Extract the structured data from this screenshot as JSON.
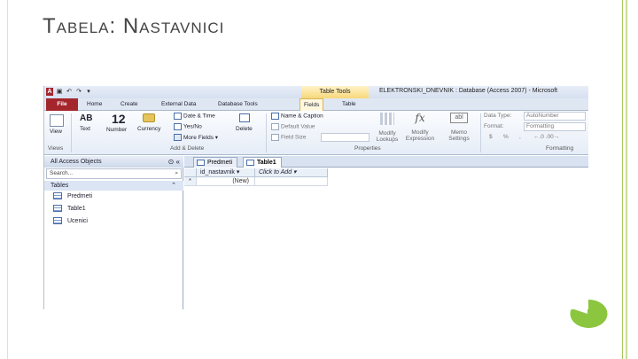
{
  "slide": {
    "title_first": "T",
    "title_rest1": "ABELA",
    "title_colon": ": ",
    "title_first2": "N",
    "title_rest2": "ASTAVNICI",
    "accent_color": "#8cc63f"
  },
  "access": {
    "context_tab_label": "Table Tools",
    "window_title": "ELEKTRONSKI_DNEVNIK : Database (Access 2007) - Microsoft",
    "tabs": [
      "File",
      "Home",
      "Create",
      "External Data",
      "Database Tools",
      "Fields",
      "Table"
    ],
    "ribbon": {
      "view": "View",
      "text": "Text",
      "number": "Number",
      "currency": "Currency",
      "ab_glyph": "AB",
      "twelve_glyph": "12",
      "date_time": "Date & Time",
      "yes_no": "Yes/No",
      "more_fields": "More Fields",
      "delete": "Delete",
      "name_caption": "Name & Caption",
      "default_value": "Default Value",
      "field_size": "Field Size",
      "modify_lookups": "Modify Lookups",
      "modify_expression": "Modify Expression",
      "memo_settings": "Memo Settings",
      "data_type": "Data Type:",
      "data_type_value": "AutoNumber",
      "format": "Format:",
      "format_value": "Formatting",
      "currency_sym": "$",
      "percent": "%",
      "comma": ",",
      "decimals": "←.0 .00→",
      "group_views": "Views",
      "group_add_delete": "Add & Delete",
      "group_properties": "Properties",
      "group_formatting": "Formatting"
    },
    "nav": {
      "header": "All Access Objects",
      "search_placeholder": "Search...",
      "group": "Tables",
      "items": [
        "Predmeti",
        "Table1",
        "Ucenici"
      ]
    },
    "doc_tabs": [
      "Predmeti",
      "Table1"
    ],
    "grid": {
      "columns": [
        "id_nastavnik",
        "Click to Add"
      ],
      "new_row_marker": "*",
      "new_value": "(New)"
    }
  }
}
